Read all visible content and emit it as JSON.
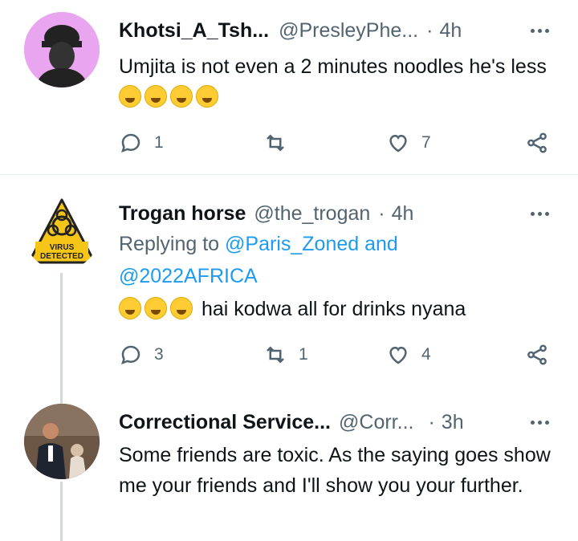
{
  "tweets": [
    {
      "name": "Khotsi_A_Tsh...",
      "handle": "@PresleyPhe...",
      "dot": "·",
      "time": "4h",
      "text": "Umjita is not even a 2 minutes noodles he's less",
      "emoji_count": 4,
      "replies": "1",
      "retweets": "",
      "likes": "7"
    },
    {
      "name": "Trogan horse",
      "handle": "@the_trogan",
      "dot": "·",
      "time": "4h",
      "reply_prefix": "Replying to ",
      "reply_user1": "@Paris_Zoned",
      "reply_and": " and",
      "reply_user2": "@2022AFRICA",
      "text": "hai kodwa all for drinks nyana",
      "emoji_count": 3,
      "avatar_text_1": "VIRUS",
      "avatar_text_2": "DETECTED",
      "replies": "3",
      "retweets": "1",
      "likes": "4"
    },
    {
      "name": "Correctional Service...",
      "handle": "@Corr...",
      "dot": "·",
      "time": "3h",
      "text": "Some friends are toxic. As the saying goes show me your friends and I'll show you your further."
    }
  ],
  "icons": {
    "reply": "reply-icon",
    "retweet": "retweet-icon",
    "like": "heart-icon",
    "share": "share-icon",
    "more": "more-icon"
  },
  "colors": {
    "link": "#1d9bf0",
    "muted": "#536471",
    "text": "#0f1419",
    "avatar1_bg": "#e9a5ef",
    "warning_yellow": "#f5c518"
  }
}
